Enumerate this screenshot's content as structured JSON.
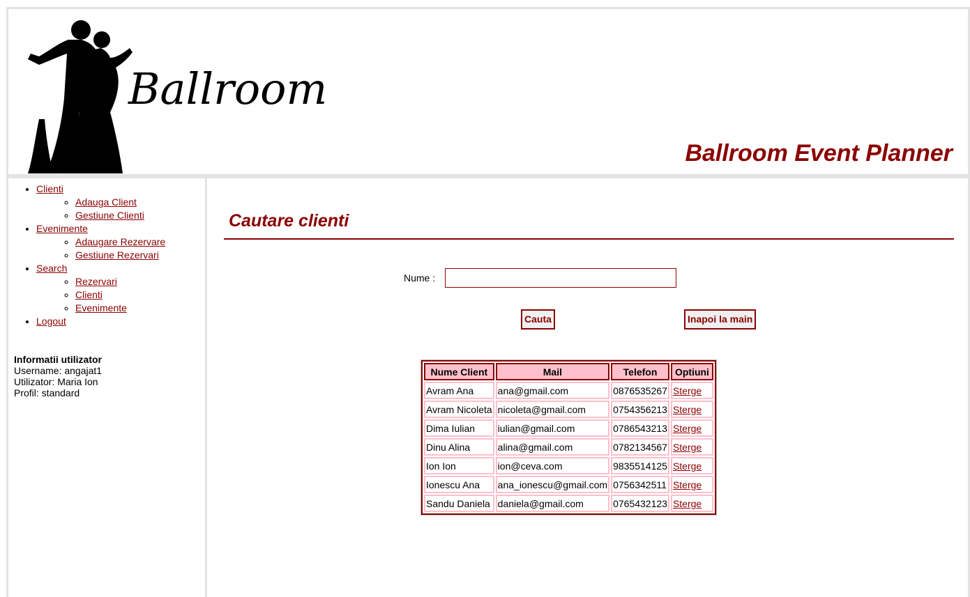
{
  "header": {
    "logo_text": "Ballroom",
    "site_title": "Ballroom Event Planner"
  },
  "nav": {
    "clienti": {
      "label": "Clienti",
      "items": [
        "Adauga Client",
        "Gestiune Clienti"
      ]
    },
    "evenimente": {
      "label": "Evenimente",
      "items": [
        "Adaugare Rezervare",
        "Gestiune Rezervari"
      ]
    },
    "search": {
      "label": "Search",
      "items": [
        "Rezervari",
        "Clienti",
        "Evenimente"
      ]
    },
    "logout": {
      "label": "Logout"
    }
  },
  "user_info": {
    "title": "Informatii utilizator",
    "username": "Username:  angajat1",
    "utilizator": "Utilizator:  Maria Ion",
    "profil": "Profil:  standard"
  },
  "main": {
    "title": "Cautare clienti",
    "name_label": "Nume :",
    "name_value": "",
    "search_button": "Cauta",
    "back_button": "Inapoi la main"
  },
  "table": {
    "headers": [
      "Nume Client",
      "Mail",
      "Telefon",
      "Optiuni"
    ],
    "rows": [
      {
        "name": "Avram Ana",
        "mail": "ana@gmail.com",
        "phone": "0876535267",
        "action": "Sterge"
      },
      {
        "name": "Avram Nicoleta",
        "mail": "nicoleta@gmail.com",
        "phone": "0754356213",
        "action": "Sterge"
      },
      {
        "name": "Dima Iulian",
        "mail": "iulian@gmail.com",
        "phone": "0786543213",
        "action": "Sterge"
      },
      {
        "name": "Dinu Alina",
        "mail": "alina@gmail.com",
        "phone": "0782134567",
        "action": "Sterge"
      },
      {
        "name": "Ion Ion",
        "mail": "ion@ceva.com",
        "phone": "9835514125",
        "action": "Sterge"
      },
      {
        "name": "Ionescu Ana",
        "mail": "ana_ionescu@gmail.com",
        "phone": "0756342511",
        "action": "Sterge"
      },
      {
        "name": "Sandu Daniela",
        "mail": "daniela@gmail.com",
        "phone": "0765432123",
        "action": "Sterge"
      }
    ]
  },
  "colors": {
    "accent": "#8b0000",
    "header_bg": "#ffc0cb",
    "border": "#e3e3e3"
  }
}
